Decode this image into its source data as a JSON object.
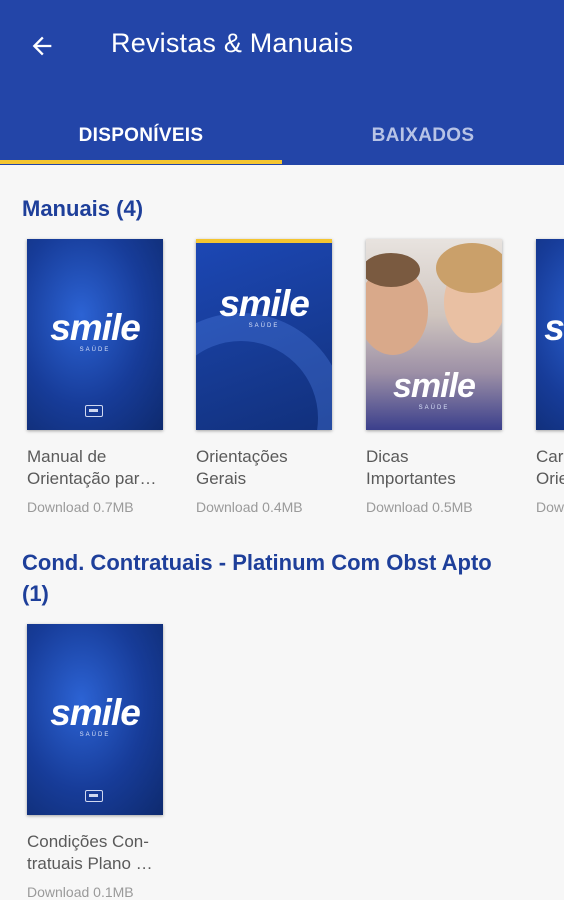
{
  "header": {
    "title": "Revistas & Manuais",
    "back_icon": "arrow-left-icon"
  },
  "tabs": [
    {
      "label": "DISPONÍVEIS",
      "selected": true
    },
    {
      "label": "BAIXADOS",
      "selected": false
    }
  ],
  "colors": {
    "primary": "#2345a8",
    "accent": "#f4c531",
    "section_title": "#1e3f9a"
  },
  "sections": [
    {
      "title": "Manuais (4)",
      "items": [
        {
          "title": "Manual de\nOrientação par…",
          "subtitle": "Download 0.7MB",
          "cover_text": "smile",
          "cover_sub": "SAÚDE"
        },
        {
          "title": "Orientações\nGerais",
          "subtitle": "Download 0.4MB",
          "cover_text": "smile",
          "cover_sub": "SAÚDE"
        },
        {
          "title": "Dicas\nImportantes",
          "subtitle": "Download 0.5MB",
          "cover_text": "smile",
          "cover_sub": "SAÚDE"
        },
        {
          "title": "Car\nOrie",
          "subtitle": "Dow",
          "cover_text": "s",
          "cover_sub": ""
        }
      ]
    },
    {
      "title": "Cond. Contratuais -  Platinum Com Obst Apto\n(1)",
      "items": [
        {
          "title": "Condições Con-\ntratuais Plano …",
          "subtitle": "Download 0.1MB",
          "cover_text": "smile",
          "cover_sub": "SAÚDE"
        }
      ]
    }
  ]
}
